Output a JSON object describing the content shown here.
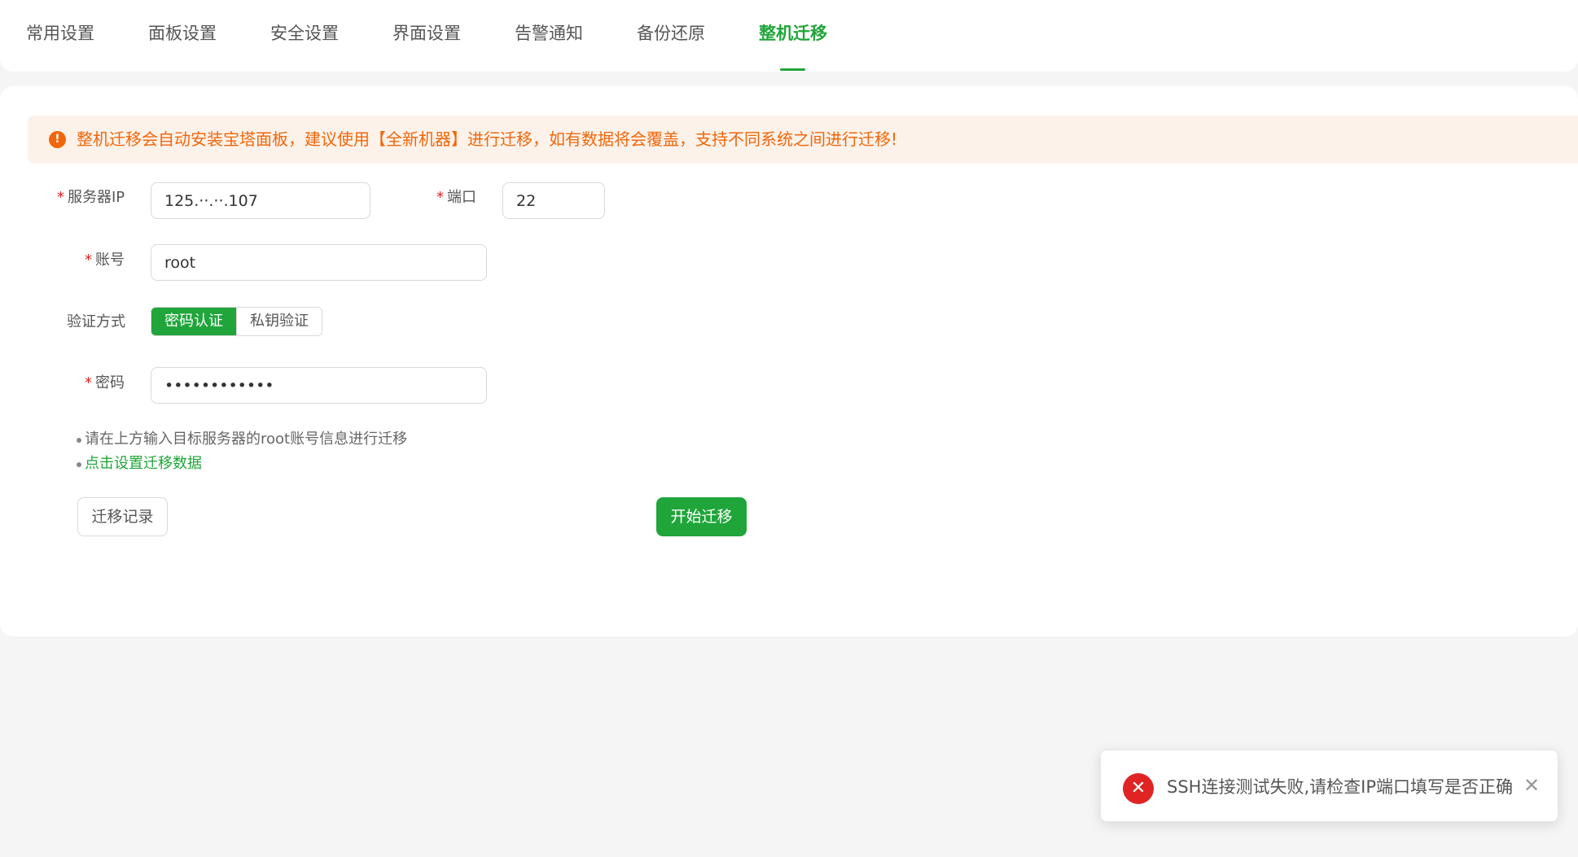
{
  "tabs": [
    {
      "label": "常用设置"
    },
    {
      "label": "面板设置"
    },
    {
      "label": "安全设置"
    },
    {
      "label": "界面设置"
    },
    {
      "label": "告警通知"
    },
    {
      "label": "备份还原"
    },
    {
      "label": "整机迁移",
      "active": true
    }
  ],
  "alert": {
    "icon": "warning-icon",
    "text": "整机迁移会自动安装宝塔面板，建议使用【全新机器】进行迁移，如有数据将会覆盖，支持不同系统之间进行迁移!"
  },
  "form": {
    "required_mark": "*",
    "server_ip": {
      "label": "服务器IP",
      "value": "125.··.··.107"
    },
    "port": {
      "label": "端口",
      "value": "22"
    },
    "account": {
      "label": "账号",
      "value": "root"
    },
    "auth": {
      "label": "验证方式",
      "options": [
        "密码认证",
        "私钥验证"
      ],
      "selected": "密码认证"
    },
    "password": {
      "label": "密码",
      "value": "••••••••••••"
    }
  },
  "help": {
    "line1": "请在上方输入目标服务器的root账号信息进行迁移",
    "link": "点击设置迁移数据"
  },
  "buttons": {
    "history": "迁移记录",
    "start": "开始迁移"
  },
  "toast": {
    "type": "error",
    "icon": "error-icon",
    "icon_glyph": "✕",
    "text": "SSH连接测试失败,请检查IP端口填写是否正确",
    "close_glyph": "✕"
  },
  "colors": {
    "accent": "#20a53a",
    "warning": "#f0660a",
    "error": "#e02424"
  }
}
